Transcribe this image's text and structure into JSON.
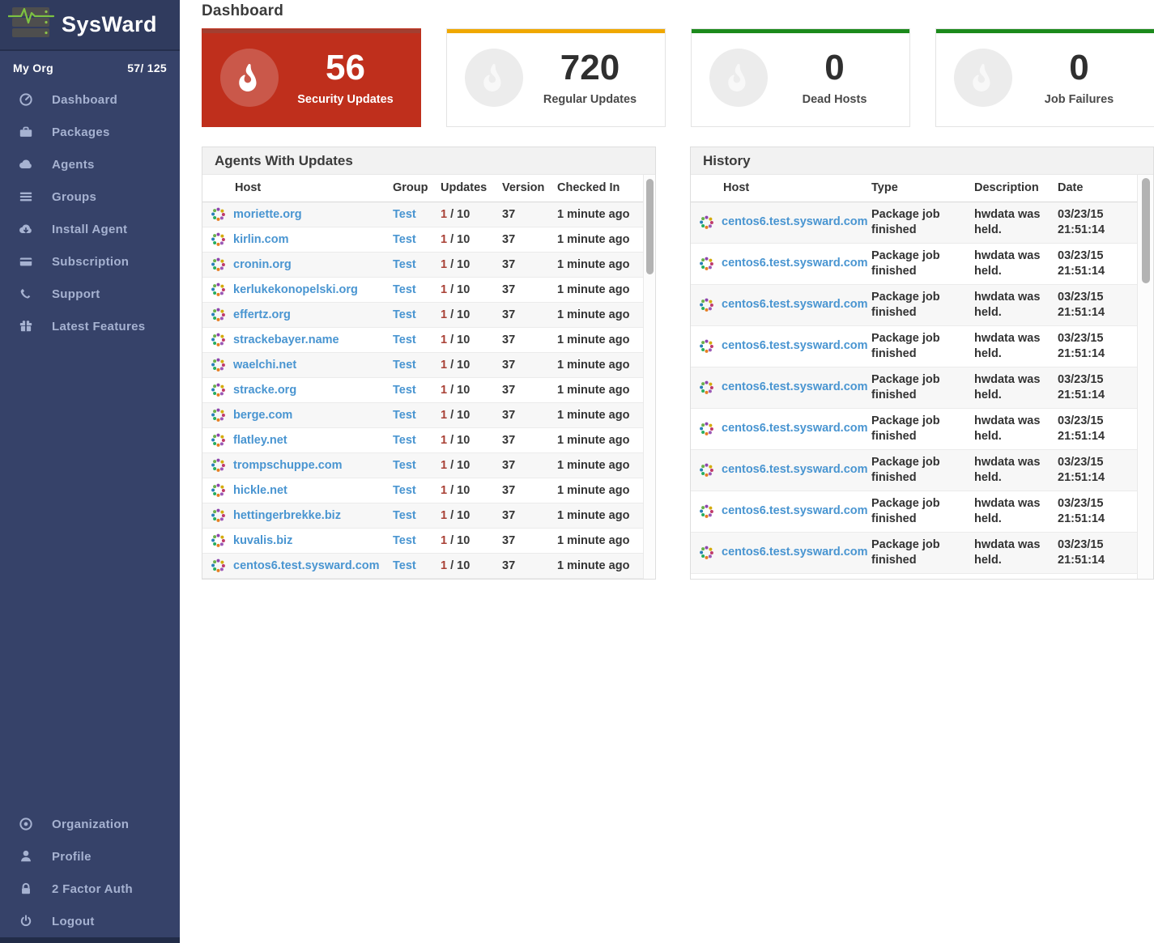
{
  "app": {
    "brand": "SysWard"
  },
  "sidebar": {
    "org": {
      "name": "My Org",
      "count": "57/ 125"
    },
    "items": [
      {
        "label": "Dashboard",
        "icon": "gauge-icon"
      },
      {
        "label": "Packages",
        "icon": "briefcase-icon"
      },
      {
        "label": "Agents",
        "icon": "cloud-icon"
      },
      {
        "label": "Groups",
        "icon": "list-icon"
      },
      {
        "label": "Install Agent",
        "icon": "cloud-download-icon"
      },
      {
        "label": "Subscription",
        "icon": "credit-card-icon"
      },
      {
        "label": "Support",
        "icon": "phone-icon"
      },
      {
        "label": "Latest Features",
        "icon": "gift-icon"
      }
    ],
    "footer_items": [
      {
        "label": "Organization",
        "icon": "target-icon"
      },
      {
        "label": "Profile",
        "icon": "user-icon"
      },
      {
        "label": "2 Factor Auth",
        "icon": "lock-icon"
      },
      {
        "label": "Logout",
        "icon": "power-icon"
      }
    ]
  },
  "header": {
    "title": "Dashboard"
  },
  "stats": [
    {
      "value": "56",
      "label": "Security Updates",
      "style": "danger",
      "accent": "#a23f31",
      "bg": "#bf2f1c",
      "icon": "flame-icon"
    },
    {
      "value": "720",
      "label": "Regular Updates",
      "style": "warn",
      "accent": "#f0a800",
      "bg": "#ffffff",
      "icon": "flame-icon"
    },
    {
      "value": "0",
      "label": "Dead Hosts",
      "style": "ok",
      "accent": "#1c8a1c",
      "bg": "#ffffff",
      "icon": "flame-icon"
    },
    {
      "value": "0",
      "label": "Job Failures",
      "style": "ok",
      "accent": "#1c8a1c",
      "bg": "#ffffff",
      "icon": "flame-icon"
    }
  ],
  "agents_panel": {
    "title": "Agents With Updates",
    "columns": [
      "Host",
      "Group",
      "Updates",
      "Version",
      "Checked In"
    ],
    "rows": [
      {
        "host": "moriette.org",
        "group": "Test",
        "updates_security": "1",
        "updates_total": "10",
        "version": "37",
        "checked_in": "1 minute ago"
      },
      {
        "host": "kirlin.com",
        "group": "Test",
        "updates_security": "1",
        "updates_total": "10",
        "version": "37",
        "checked_in": "1 minute ago"
      },
      {
        "host": "cronin.org",
        "group": "Test",
        "updates_security": "1",
        "updates_total": "10",
        "version": "37",
        "checked_in": "1 minute ago"
      },
      {
        "host": "kerlukekonopelski.org",
        "group": "Test",
        "updates_security": "1",
        "updates_total": "10",
        "version": "37",
        "checked_in": "1 minute ago"
      },
      {
        "host": "effertz.org",
        "group": "Test",
        "updates_security": "1",
        "updates_total": "10",
        "version": "37",
        "checked_in": "1 minute ago"
      },
      {
        "host": "strackebayer.name",
        "group": "Test",
        "updates_security": "1",
        "updates_total": "10",
        "version": "37",
        "checked_in": "1 minute ago"
      },
      {
        "host": "waelchi.net",
        "group": "Test",
        "updates_security": "1",
        "updates_total": "10",
        "version": "37",
        "checked_in": "1 minute ago"
      },
      {
        "host": "stracke.org",
        "group": "Test",
        "updates_security": "1",
        "updates_total": "10",
        "version": "37",
        "checked_in": "1 minute ago"
      },
      {
        "host": "berge.com",
        "group": "Test",
        "updates_security": "1",
        "updates_total": "10",
        "version": "37",
        "checked_in": "1 minute ago"
      },
      {
        "host": "flatley.net",
        "group": "Test",
        "updates_security": "1",
        "updates_total": "10",
        "version": "37",
        "checked_in": "1 minute ago"
      },
      {
        "host": "trompschuppe.com",
        "group": "Test",
        "updates_security": "1",
        "updates_total": "10",
        "version": "37",
        "checked_in": "1 minute ago"
      },
      {
        "host": "hickle.net",
        "group": "Test",
        "updates_security": "1",
        "updates_total": "10",
        "version": "37",
        "checked_in": "1 minute ago"
      },
      {
        "host": "hettingerbrekke.biz",
        "group": "Test",
        "updates_security": "1",
        "updates_total": "10",
        "version": "37",
        "checked_in": "1 minute ago"
      },
      {
        "host": "kuvalis.biz",
        "group": "Test",
        "updates_security": "1",
        "updates_total": "10",
        "version": "37",
        "checked_in": "1 minute ago"
      },
      {
        "host": "centos6.test.sysward.com",
        "group": "Test",
        "updates_security": "1",
        "updates_total": "10",
        "version": "37",
        "checked_in": "1 minute ago"
      }
    ]
  },
  "history_panel": {
    "title": "History",
    "columns": [
      "Host",
      "Type",
      "Description",
      "Date"
    ],
    "rows": [
      {
        "host": "centos6.test.sysward.com",
        "type": "Package job finished",
        "description": "hwdata was held.",
        "date": "03/23/15 21:51:14"
      },
      {
        "host": "centos6.test.sysward.com",
        "type": "Package job finished",
        "description": "hwdata was held.",
        "date": "03/23/15 21:51:14"
      },
      {
        "host": "centos6.test.sysward.com",
        "type": "Package job finished",
        "description": "hwdata was held.",
        "date": "03/23/15 21:51:14"
      },
      {
        "host": "centos6.test.sysward.com",
        "type": "Package job finished",
        "description": "hwdata was held.",
        "date": "03/23/15 21:51:14"
      },
      {
        "host": "centos6.test.sysward.com",
        "type": "Package job finished",
        "description": "hwdata was held.",
        "date": "03/23/15 21:51:14"
      },
      {
        "host": "centos6.test.sysward.com",
        "type": "Package job finished",
        "description": "hwdata was held.",
        "date": "03/23/15 21:51:14"
      },
      {
        "host": "centos6.test.sysward.com",
        "type": "Package job finished",
        "description": "hwdata was held.",
        "date": "03/23/15 21:51:14"
      },
      {
        "host": "centos6.test.sysward.com",
        "type": "Package job finished",
        "description": "hwdata was held.",
        "date": "03/23/15 21:51:14"
      },
      {
        "host": "centos6.test.sysward.com",
        "type": "Package job finished",
        "description": "hwdata was held.",
        "date": "03/23/15 21:51:14"
      }
    ]
  },
  "colors": {
    "sidebar_bg": "#364269",
    "sidebar_logo_bg": "#303b5e",
    "sidebar_text": "#a6b2d1",
    "danger_card": "#bf2f1c",
    "danger_accent": "#a23f31",
    "warn_accent": "#f0a800",
    "ok_accent": "#1c8a1c",
    "link_blue": "#4995d1",
    "security_red": "#a94136"
  }
}
